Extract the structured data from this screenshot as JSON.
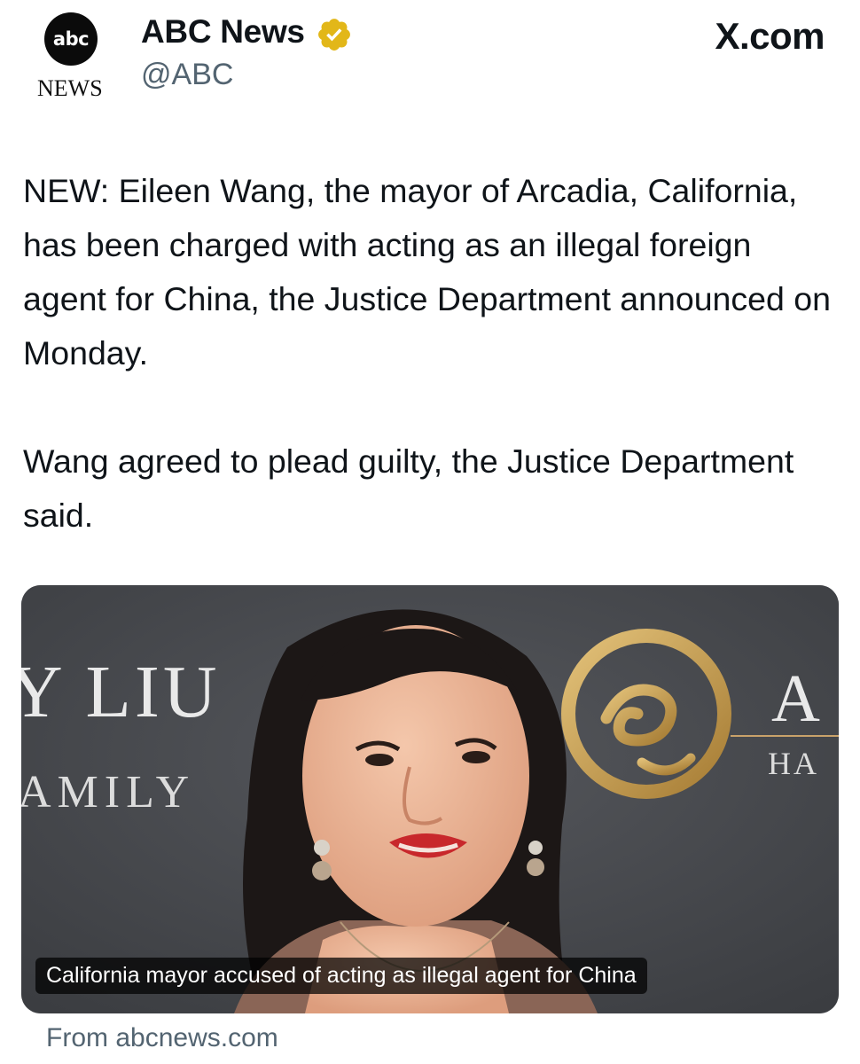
{
  "header": {
    "logo_top": "abc",
    "logo_bottom": "NEWS",
    "author_name": "ABC News",
    "author_handle": "@ABC",
    "site_label": "X.com",
    "verified_color": "#e2b719"
  },
  "tweet": {
    "paragraphs": [
      "NEW: Eileen Wang, the mayor of Arcadia, California, has been charged with acting as an illegal foreign agent for China, the Justice Department announced on Monday.",
      "Wang agreed to plead guilty, the Justice Department said."
    ]
  },
  "media": {
    "backdrop_text_left_top": "Y LIU",
    "backdrop_text_left_bottom": "AMILY",
    "backdrop_text_right_top": "A",
    "backdrop_text_right_bottom": "HA",
    "caption": "California mayor accused of acting as illegal agent for China",
    "source": "From abcnews.com"
  }
}
